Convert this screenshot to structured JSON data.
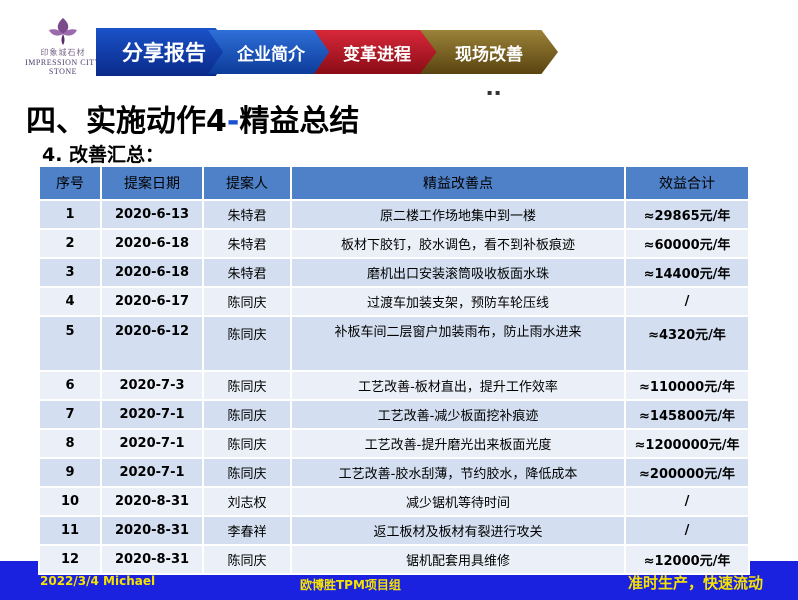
{
  "logo": {
    "cn": "印象城石材",
    "en_line1": "IMPRESSION CITY",
    "en_line2": "STONE"
  },
  "nav": [
    {
      "label": "分享报告"
    },
    {
      "label": "企业简介"
    },
    {
      "label": "变革进程"
    },
    {
      "label": "现场改善"
    }
  ],
  "title": {
    "prefix": "四、实施动作4",
    "dash": "-",
    "suffix": "精益总结"
  },
  "subtitle": "4. 改善汇总：",
  "table": {
    "headers": [
      "序号",
      "提案日期",
      "提案人",
      "精益改善点",
      "效益合计"
    ],
    "rows": [
      {
        "no": "1",
        "date": "2020-6-13",
        "person": "朱特君",
        "point": "原二楼工作场地集中到一楼",
        "benefit": "≈29865元/年"
      },
      {
        "no": "2",
        "date": "2020-6-18",
        "person": "朱特君",
        "point": "板材下胶钉，胶水调色，看不到补板痕迹",
        "benefit": "≈60000元/年"
      },
      {
        "no": "3",
        "date": "2020-6-18",
        "person": "朱特君",
        "point": "磨机出口安装滚筒吸收板面水珠",
        "benefit": "≈14400元/年"
      },
      {
        "no": "4",
        "date": "2020-6-17",
        "person": "陈同庆",
        "point": "过渡车加装支架，预防车轮压线",
        "benefit": "/"
      },
      {
        "no": "5",
        "date": "2020-6-12",
        "person": "陈同庆",
        "point": "补板车间二层窗户加装雨布，防止雨水进来",
        "benefit": "≈4320元/年"
      },
      {
        "no": "6",
        "date": "2020-7-3",
        "person": "陈同庆",
        "point": "工艺改善-板材直出，提升工作效率",
        "benefit": "≈110000元/年"
      },
      {
        "no": "7",
        "date": "2020-7-1",
        "person": "陈同庆",
        "point": "工艺改善-减少板面挖补痕迹",
        "benefit": "≈145800元/年"
      },
      {
        "no": "8",
        "date": "2020-7-1",
        "person": "陈同庆",
        "point": "工艺改善-提升磨光出来板面光度",
        "benefit": "≈1200000元/年"
      },
      {
        "no": "9",
        "date": "2020-7-1",
        "person": "陈同庆",
        "point": "工艺改善-胶水刮薄，节约胶水，降低成本",
        "benefit": "≈200000元/年"
      },
      {
        "no": "10",
        "date": "2020-8-31",
        "person": "刘志权",
        "point": "减少锯机等待时间",
        "benefit": "/"
      },
      {
        "no": "11",
        "date": "2020-8-31",
        "person": "李春祥",
        "point": "返工板材及板材有裂进行攻关",
        "benefit": "/"
      },
      {
        "no": "12",
        "date": "2020-8-31",
        "person": "陈同庆",
        "point": "锯机配套用具维修",
        "benefit": "≈12000元/年"
      }
    ]
  },
  "footer": {
    "date": "2022/3/4 Michael",
    "center": "欧博胜TPM项目组",
    "slogan": "准时生产，快速流动"
  },
  "colors": {
    "header_blue": "#4f81c8",
    "row_odd": "#d3dff0",
    "row_even": "#ebf0f8",
    "bottom_bar": "#1a22e0",
    "footer_text": "#f7e300",
    "title_dash": "#1a4fd0"
  }
}
